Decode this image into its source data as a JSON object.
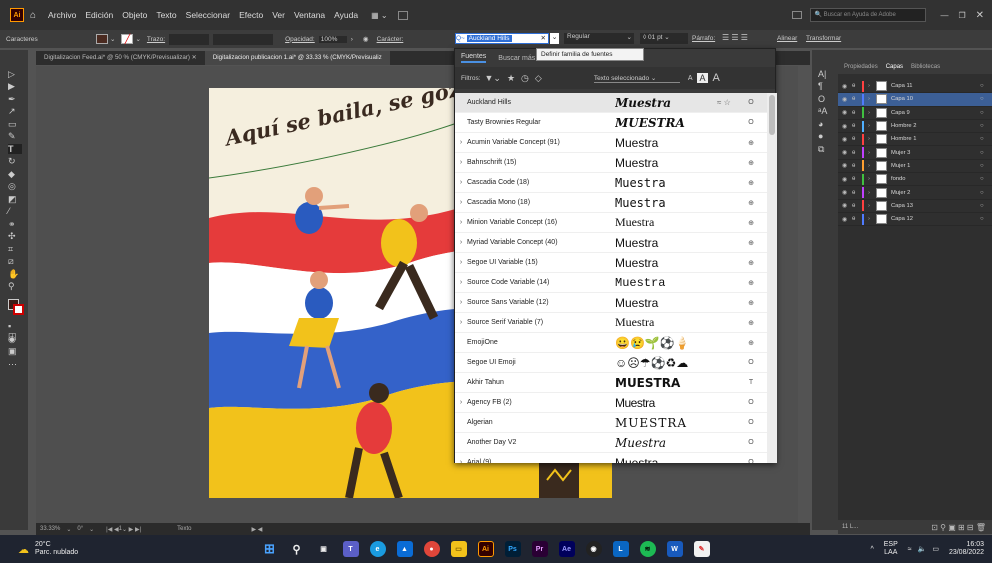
{
  "menubar": {
    "app": "Ai",
    "items": [
      "Archivo",
      "Edición",
      "Objeto",
      "Texto",
      "Seleccionar",
      "Efecto",
      "Ver",
      "Ventana",
      "Ayuda"
    ],
    "search_placeholder": "Buscar en Ayuda de Adobe"
  },
  "control": {
    "label_caracteres": "Caracteres",
    "trazo": "Trazo:",
    "opacidad_label": "Opacidad:",
    "opacidad": "100%",
    "caracter_label": "Carácter:",
    "font_value": "Auckland Hills",
    "style": "Regular",
    "size": "01 pt",
    "parrafo": "Párrafo:",
    "alinear": "Alinear",
    "transformar": "Transformar"
  },
  "tabs": [
    "Digitalizacion Feed.ai* @ 50 % (CMYK/Previsualizar)",
    "Digitalizacion publicacion 1.ai* @ 33.33 % (CMYK/Previsualiz"
  ],
  "tooltip": "Definir familia de fuentes",
  "artboard": {
    "headline": "Aquí se baila, se goza"
  },
  "fontpanel": {
    "tab_fuentes": "Fuentes",
    "tab_mas": "Buscar más",
    "filters_label": "Filtros:",
    "preview_label": "Texto seleccionado",
    "rows": [
      {
        "name": "Auckland Hills",
        "sample": "Muestra",
        "stat": "≈ ☆",
        "type": "O",
        "selected": true,
        "chev": ""
      },
      {
        "name": "Tasty Brownies Regular",
        "sample": "MUESTRA",
        "stat": "",
        "type": "O",
        "chev": ""
      },
      {
        "name": "Acumin Variable Concept (91)",
        "sample": "Muestra",
        "stat": "",
        "type": "⊕",
        "chev": "›"
      },
      {
        "name": "Bahnschrift (15)",
        "sample": "Muestra",
        "stat": "",
        "type": "⊕",
        "chev": "›"
      },
      {
        "name": "Cascadia Code (18)",
        "sample": "Muestra",
        "stat": "",
        "type": "⊕",
        "chev": "›"
      },
      {
        "name": "Cascadia Mono (18)",
        "sample": "Muestra",
        "stat": "",
        "type": "⊕",
        "chev": "›"
      },
      {
        "name": "Minion Variable Concept (16)",
        "sample": "Muestra",
        "stat": "",
        "type": "⊕",
        "chev": "›"
      },
      {
        "name": "Myriad Variable Concept (40)",
        "sample": "Muestra",
        "stat": "",
        "type": "⊕",
        "chev": "›"
      },
      {
        "name": "Segoe UI Variable (15)",
        "sample": "Muestra",
        "stat": "",
        "type": "⊕",
        "chev": "›"
      },
      {
        "name": "Source Code Variable (14)",
        "sample": "Muestra",
        "stat": "",
        "type": "⊕",
        "chev": "›"
      },
      {
        "name": "Source Sans Variable (12)",
        "sample": "Muestra",
        "stat": "",
        "type": "⊕",
        "chev": "›"
      },
      {
        "name": "Source Serif Variable (7)",
        "sample": "Muestra",
        "stat": "",
        "type": "⊕",
        "chev": "›"
      },
      {
        "name": "EmojiOne",
        "sample": "😀😢🌱⚽🍦",
        "stat": "",
        "type": "⊕",
        "chev": ""
      },
      {
        "name": "Segoe UI Emoji",
        "sample": "☺☹☂⚽♻☁",
        "stat": "",
        "type": "O",
        "chev": ""
      },
      {
        "name": "Akhir Tahun",
        "sample": "MUESTRA",
        "stat": "",
        "type": "T",
        "chev": ""
      },
      {
        "name": "Agency FB (2)",
        "sample": "Muestra",
        "stat": "",
        "type": "O",
        "chev": "›"
      },
      {
        "name": "Algerian",
        "sample": "MUESTRA",
        "stat": "",
        "type": "O",
        "chev": ""
      },
      {
        "name": "Another Day V2",
        "sample": "Muestra",
        "stat": "",
        "type": "O",
        "chev": ""
      },
      {
        "name": "Arial (9)",
        "sample": "Muestra",
        "stat": "",
        "type": "O",
        "chev": "›"
      }
    ]
  },
  "props": {
    "tab1": "Propiedades",
    "tab2": "Capas",
    "tab3": "Bibliotecas"
  },
  "layers": [
    {
      "name": "Capa 11",
      "color": "#ff4040"
    },
    {
      "name": "Capa 10",
      "color": "#4f7bff",
      "selected": true
    },
    {
      "name": "Capa 9",
      "color": "#40c040"
    },
    {
      "name": "Hombre 2",
      "color": "#4fb0ff"
    },
    {
      "name": "Hombre 1",
      "color": "#ff4040"
    },
    {
      "name": "Mujer 3",
      "color": "#c040ff"
    },
    {
      "name": "Mujer 1",
      "color": "#ff9f30"
    },
    {
      "name": "fondo",
      "color": "#40c040"
    },
    {
      "name": "Mujer 2",
      "color": "#c040ff"
    },
    {
      "name": "Capa 13",
      "color": "#ff4040"
    },
    {
      "name": "Capa 12",
      "color": "#4f7bff"
    }
  ],
  "layers_count": "11 L...",
  "status": {
    "zoom": "33.33%",
    "angle": "0°",
    "page": "1",
    "tool": "Texto"
  },
  "taskbar": {
    "weather_temp": "20°C",
    "weather_desc": "Parc. nublado",
    "lang1": "ESP",
    "lang2": "LAA",
    "time": "16:03",
    "date": "23/08/2022"
  }
}
